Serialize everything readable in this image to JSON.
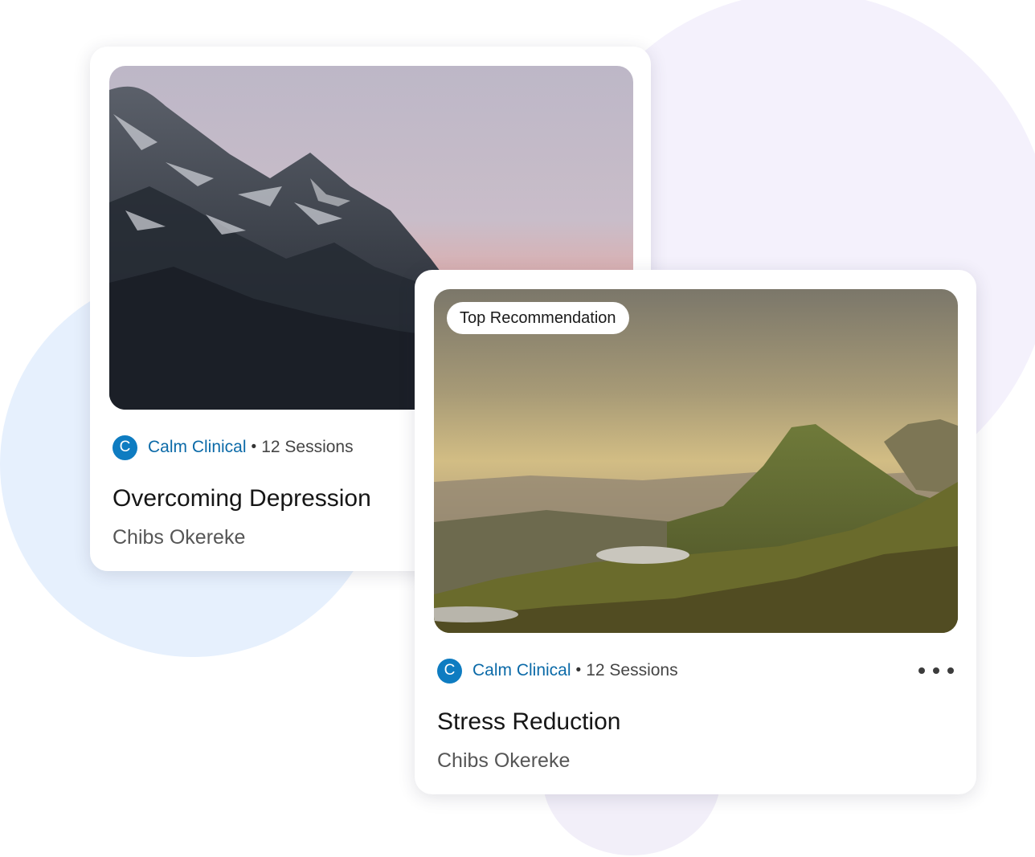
{
  "colors": {
    "brand": "#0e7cc1",
    "provider_text": "#0b6aa8",
    "background_lavender": "#f4f1fc",
    "background_blue": "#e6f0fd"
  },
  "cards": [
    {
      "image": "snowy-mountain-peak-at-dusk",
      "provider_initial": "C",
      "provider": "Calm Clinical",
      "separator": "•",
      "sessions": "12 Sessions",
      "title": "Overcoming Depression",
      "author": "Chibs Okereke"
    },
    {
      "image": "green-hills-and-lakes-at-sunrise",
      "badge": "Top Recommendation",
      "provider_initial": "C",
      "provider": "Calm Clinical",
      "separator": "•",
      "sessions": "12 Sessions",
      "title": "Stress Reduction",
      "author": "Chibs Okereke",
      "more_icon": "more-horizontal-icon"
    }
  ]
}
